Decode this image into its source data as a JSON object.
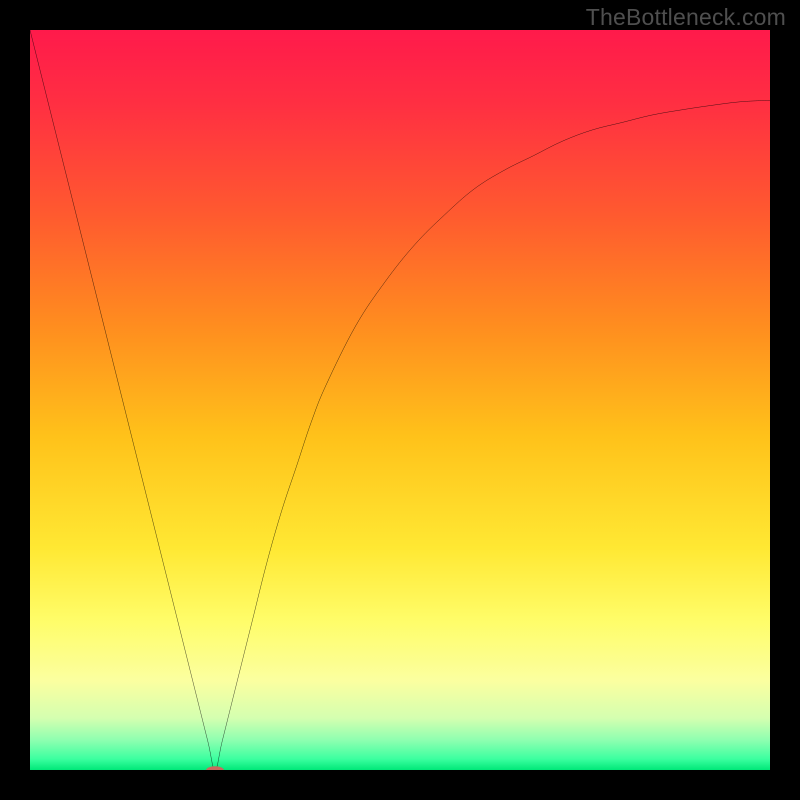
{
  "watermark": "TheBottleneck.com",
  "chart_data": {
    "type": "line",
    "title": "",
    "xlabel": "",
    "ylabel": "",
    "xlim": [
      0,
      100
    ],
    "ylim": [
      0,
      100
    ],
    "grid": false,
    "legend": false,
    "series": [
      {
        "name": "curve",
        "x": [
          0,
          2,
          4,
          6,
          8,
          10,
          12,
          14,
          16,
          18,
          20,
          22,
          24,
          25,
          26,
          28,
          30,
          32,
          34,
          36,
          38,
          40,
          44,
          48,
          52,
          56,
          60,
          64,
          68,
          72,
          76,
          80,
          84,
          88,
          92,
          96,
          100
        ],
        "y": [
          100,
          92,
          84,
          76,
          68,
          60,
          52,
          44,
          36,
          28,
          20,
          12,
          4,
          0,
          4,
          12,
          20,
          28,
          35,
          41,
          47,
          52,
          60,
          66,
          71,
          75,
          78.5,
          81,
          83,
          85,
          86.5,
          87.5,
          88.5,
          89.2,
          89.8,
          90.3,
          90.5
        ]
      }
    ],
    "marker": {
      "x": 25,
      "y": 0,
      "rx": 1.2,
      "ry": 0.5,
      "color": "#c96a5e"
    },
    "colors": {
      "background_gradient": [
        {
          "offset": 0.0,
          "color": "#ff1a4b"
        },
        {
          "offset": 0.1,
          "color": "#ff2f42"
        },
        {
          "offset": 0.25,
          "color": "#ff5a2f"
        },
        {
          "offset": 0.4,
          "color": "#ff8d1f"
        },
        {
          "offset": 0.55,
          "color": "#ffc21a"
        },
        {
          "offset": 0.7,
          "color": "#ffe833"
        },
        {
          "offset": 0.8,
          "color": "#fffd6a"
        },
        {
          "offset": 0.88,
          "color": "#fbffa0"
        },
        {
          "offset": 0.93,
          "color": "#d4ffb0"
        },
        {
          "offset": 0.96,
          "color": "#8dffb0"
        },
        {
          "offset": 0.985,
          "color": "#3cffa0"
        },
        {
          "offset": 1.0,
          "color": "#00e878"
        }
      ]
    }
  }
}
